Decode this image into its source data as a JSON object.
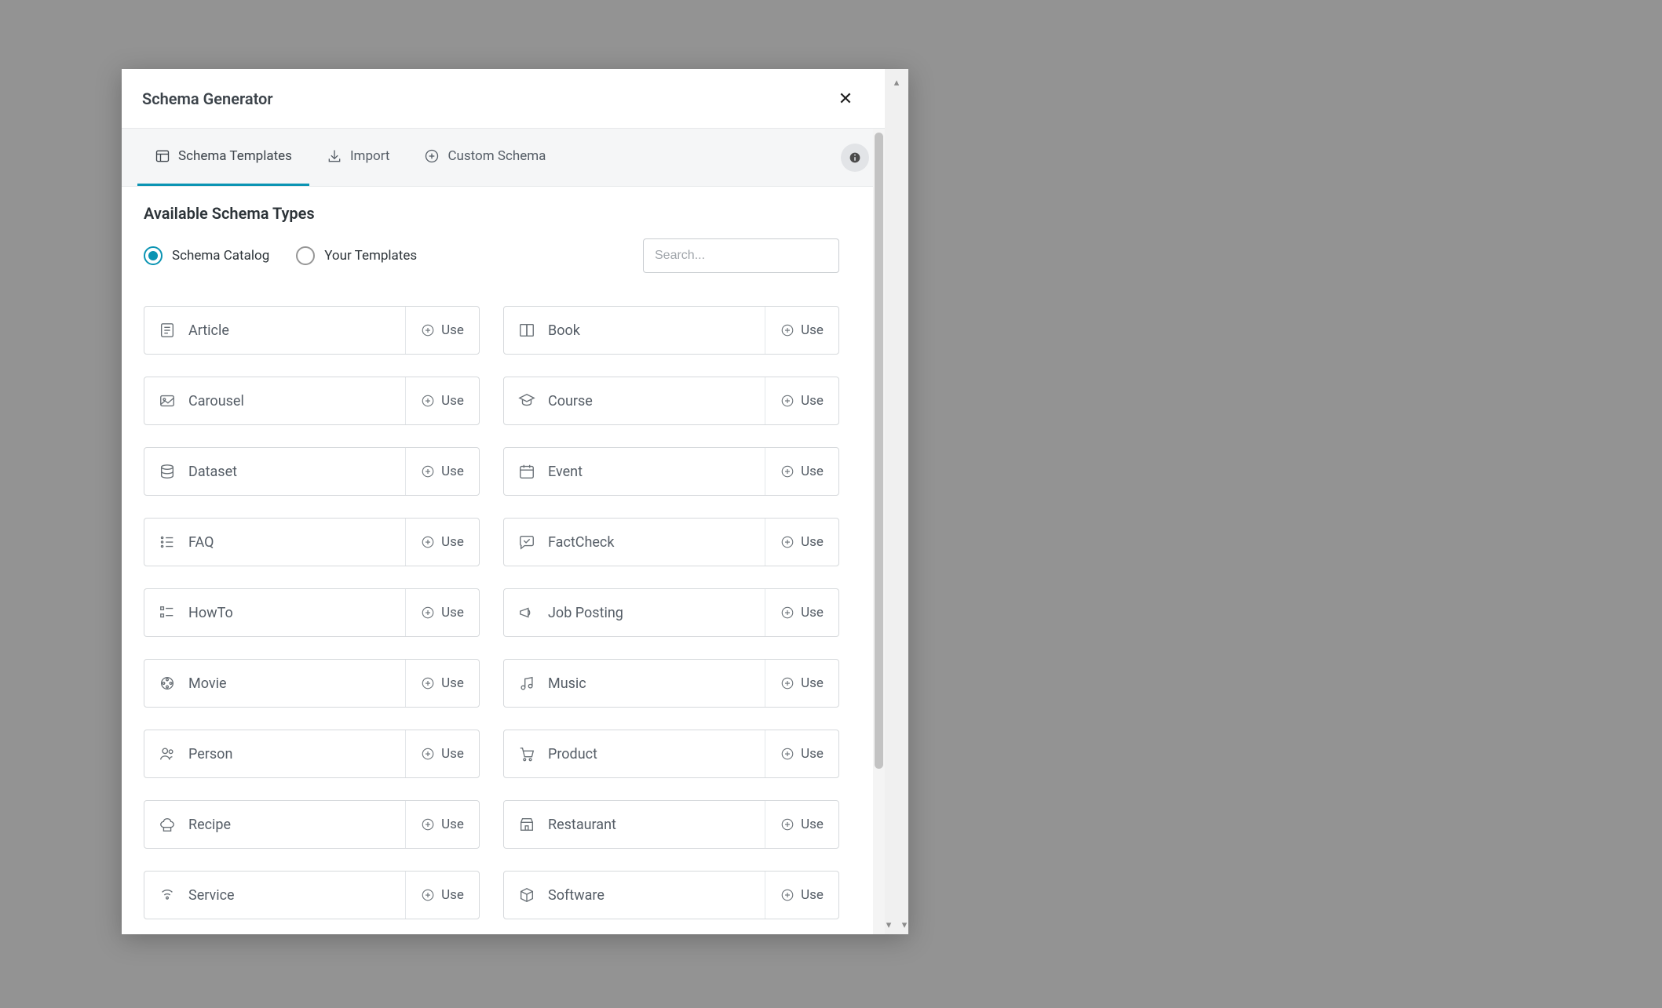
{
  "modal": {
    "title": "Schema Generator"
  },
  "tabs": {
    "templates": "Schema Templates",
    "import": "Import",
    "custom": "Custom Schema"
  },
  "section": {
    "heading": "Available Schema Types"
  },
  "filters": {
    "catalog": "Schema Catalog",
    "your_templates": "Your Templates",
    "search_placeholder": "Search..."
  },
  "use_label": "Use",
  "schemas": [
    {
      "id": "article",
      "label": "Article",
      "icon": "file-text"
    },
    {
      "id": "book",
      "label": "Book",
      "icon": "book"
    },
    {
      "id": "carousel",
      "label": "Carousel",
      "icon": "gallery"
    },
    {
      "id": "course",
      "label": "Course",
      "icon": "graduation"
    },
    {
      "id": "dataset",
      "label": "Dataset",
      "icon": "database"
    },
    {
      "id": "event",
      "label": "Event",
      "icon": "calendar"
    },
    {
      "id": "faq",
      "label": "FAQ",
      "icon": "list"
    },
    {
      "id": "factcheck",
      "label": "FactCheck",
      "icon": "message-check"
    },
    {
      "id": "howto",
      "label": "HowTo",
      "icon": "steps"
    },
    {
      "id": "jobposting",
      "label": "Job Posting",
      "icon": "megaphone"
    },
    {
      "id": "movie",
      "label": "Movie",
      "icon": "film"
    },
    {
      "id": "music",
      "label": "Music",
      "icon": "music"
    },
    {
      "id": "person",
      "label": "Person",
      "icon": "users"
    },
    {
      "id": "product",
      "label": "Product",
      "icon": "cart"
    },
    {
      "id": "recipe",
      "label": "Recipe",
      "icon": "chef"
    },
    {
      "id": "restaurant",
      "label": "Restaurant",
      "icon": "shop"
    },
    {
      "id": "service",
      "label": "Service",
      "icon": "signal"
    },
    {
      "id": "software",
      "label": "Software",
      "icon": "package"
    }
  ]
}
